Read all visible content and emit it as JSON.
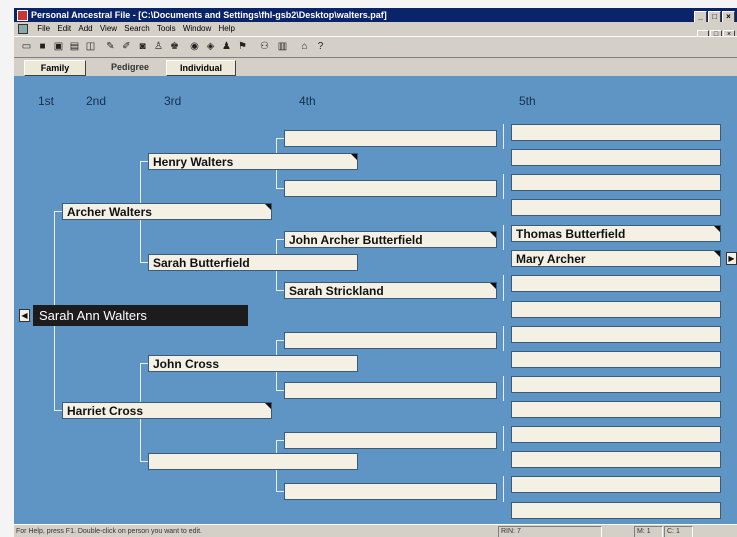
{
  "window": {
    "title": "Personal Ancestral File - [C:\\Documents and Settings\\fhl-gsb2\\Desktop\\walters.paf]",
    "controls": [
      "_",
      "□",
      "×"
    ]
  },
  "menu": [
    "File",
    "Edit",
    "Add",
    "View",
    "Search",
    "Tools",
    "Window",
    "Help"
  ],
  "toolbar_icons": [
    "open-icon",
    "save-icon",
    "save-as-icon",
    "print-icon",
    "printer-icon",
    "edit-individual-icon",
    "edit-marriage-icon",
    "camera-icon",
    "add-parents-icon",
    "add-spouse-icon",
    "search-icon",
    "find-icon",
    "index-icon",
    "match-icon",
    "merge-icon",
    "book-icon",
    "home-icon",
    "help-icon"
  ],
  "tabs": [
    {
      "label": "Family",
      "active": false
    },
    {
      "label": "Pedigree",
      "active": true
    },
    {
      "label": "Individual",
      "active": false
    }
  ],
  "generations": [
    "1st",
    "2nd",
    "3rd",
    "4th",
    "5th"
  ],
  "pedigree": {
    "primary": "Sarah Ann Walters",
    "gen2": [
      "Archer Walters",
      "Harriet Cross"
    ],
    "gen3": [
      "Henry Walters",
      "Sarah Butterfield",
      "John Cross",
      ""
    ],
    "gen4": [
      "",
      "",
      "John Archer Butterfield",
      "Sarah Strickland",
      "",
      "",
      "",
      ""
    ],
    "gen5": [
      "",
      "",
      "",
      "",
      "Thomas Butterfield",
      "Mary Archer",
      "",
      "",
      "",
      "",
      "",
      "",
      "",
      "",
      "",
      ""
    ]
  },
  "status": {
    "help_text": "For Help, press F1. Double-click on person you want to edit.",
    "rin": "RIN: 7",
    "field2": "M: 1",
    "field3": "C: 1"
  }
}
